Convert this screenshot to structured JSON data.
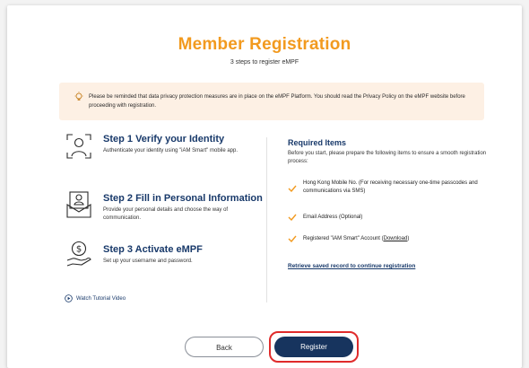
{
  "header": {
    "title": "Member Registration",
    "subtitle": "3 steps to register eMPF"
  },
  "notice": {
    "text": "Please be reminded that data privacy protection measures are in place on the eMPF Platform. You should read the Privacy Policy on the eMPF website before proceeding with registration.",
    "icon": "lightbulb-icon"
  },
  "steps": [
    {
      "title": "Step 1 Verify your Identity",
      "desc": "Authenticate your identity using \"iAM Smart\" mobile app.",
      "icon": "face-scan-icon"
    },
    {
      "title": "Step 2 Fill in Personal Information",
      "desc": "Provide your personal details and choose the way of communication.",
      "icon": "id-card-icon"
    },
    {
      "title": "Step 3 Activate eMPF",
      "desc": "Set up your username and password.",
      "icon": "coin-hand-icon"
    }
  ],
  "watch_label": "Watch Tutorial Video",
  "required": {
    "title": "Required Items",
    "desc": "Before you start, please prepare the following items to ensure a smooth registration process:",
    "items": [
      "Hong Kong Mobile No. (For receiving necessary one-time passcodes and communications via SMS)",
      "Email Address (Optional)",
      "Registered \"iAM Smart\" Account ("
    ],
    "download_label": "Download",
    "item3_suffix": ")",
    "retrieve_label": "Retrieve saved record to continue registration"
  },
  "buttons": {
    "back": "Back",
    "register": "Register"
  },
  "colors": {
    "accent": "#f29a1f",
    "navy": "#17345e",
    "highlight": "#e02b2b",
    "notice_bg": "#fdf0e4"
  }
}
